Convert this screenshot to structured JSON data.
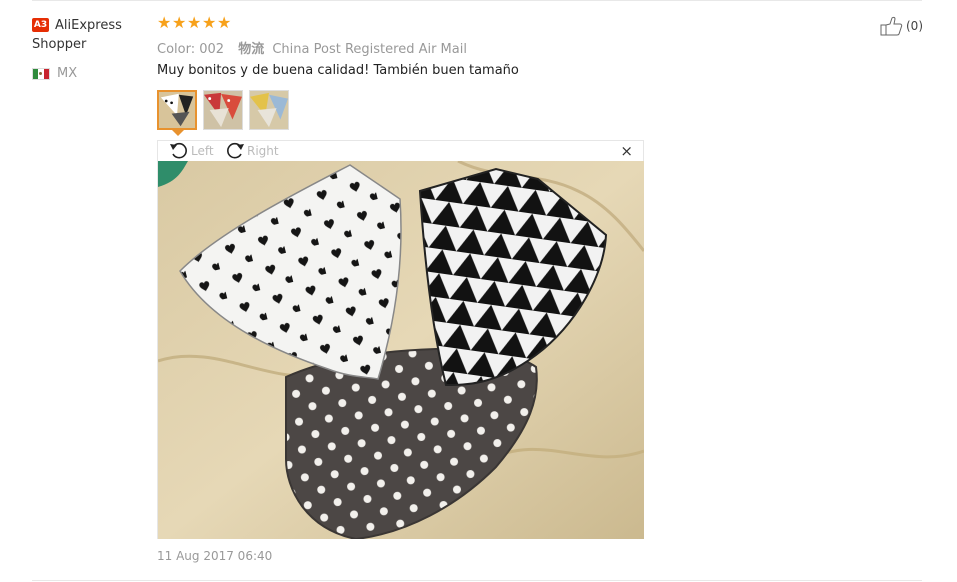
{
  "buyer": {
    "level": "A3",
    "name": "AliExpress Shopper",
    "country": "MX"
  },
  "rating": {
    "stars": 5,
    "max": 5
  },
  "meta": {
    "color_label": "Color:",
    "color_value": "002",
    "logistics_label": "物流",
    "logistics_value": "China Post Registered Air Mail"
  },
  "review": {
    "text": "Muy bonitos y de buena calidad! También buen tamaño",
    "date": "11 Aug 2017 06:40"
  },
  "helpful": {
    "count": "(0)"
  },
  "viewer": {
    "rotate_left": "Left",
    "rotate_right": "Right",
    "close": "×"
  },
  "thumbnails": [
    {
      "selected": true
    },
    {
      "selected": false
    },
    {
      "selected": false
    }
  ]
}
